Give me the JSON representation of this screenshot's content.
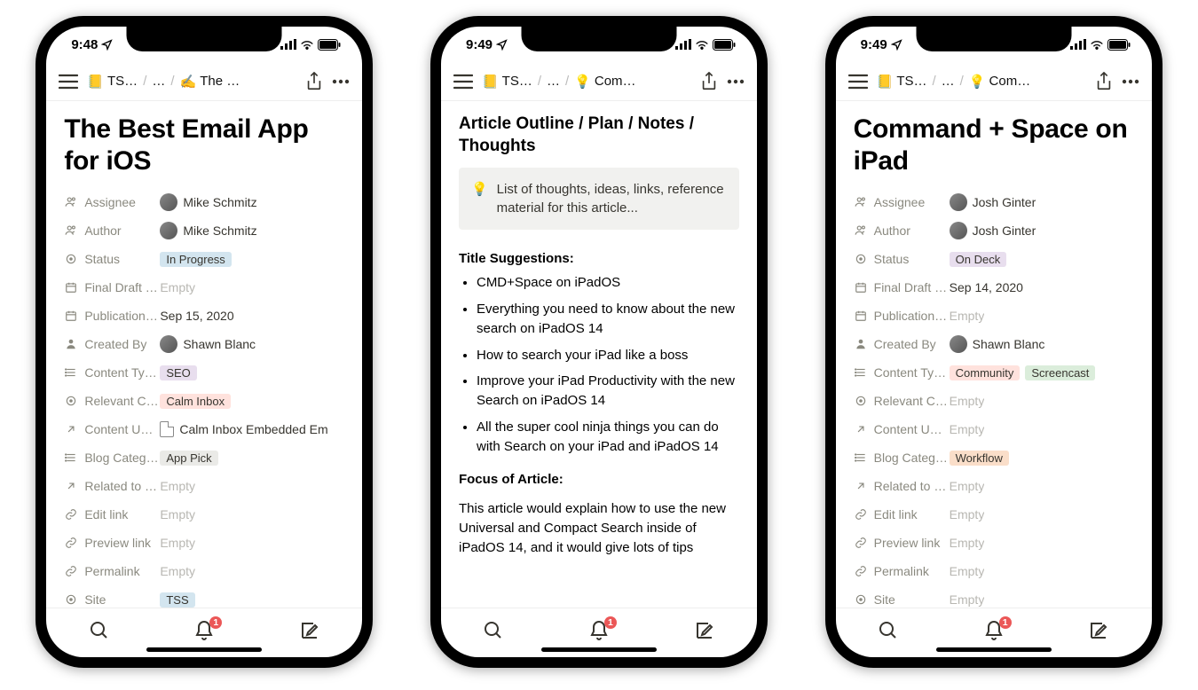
{
  "status_bar": {
    "time_a": "9:48",
    "time_b": "9:49",
    "time_c": "9:49"
  },
  "breadcrumb": {
    "root_emoji": "📒",
    "root": "TS…",
    "mid": "…",
    "leaf_a_emoji": "✍️",
    "leaf_a": "The …",
    "leaf_b_emoji": "💡",
    "leaf_b": "Com…",
    "leaf_c_emoji": "💡",
    "leaf_c": "Com…"
  },
  "phone1": {
    "title": "The Best Email App for iOS",
    "props": [
      {
        "icon": "person",
        "label": "Assignee",
        "type": "person",
        "name": "Mike Schmitz"
      },
      {
        "icon": "person",
        "label": "Author",
        "type": "person",
        "name": "Mike Schmitz"
      },
      {
        "icon": "status",
        "label": "Status",
        "type": "tag",
        "value": "In Progress",
        "color": "#d3e5ef"
      },
      {
        "icon": "date",
        "label": "Final Draft …",
        "type": "empty",
        "value": "Empty"
      },
      {
        "icon": "date",
        "label": "Publication…",
        "type": "text",
        "value": "Sep 15, 2020"
      },
      {
        "icon": "person-solid",
        "label": "Created By",
        "type": "person",
        "name": "Shawn Blanc"
      },
      {
        "icon": "multi",
        "label": "Content Ty…",
        "type": "tag",
        "value": "SEO",
        "color": "#e8deee"
      },
      {
        "icon": "status",
        "label": "Relevant C…",
        "type": "tag",
        "value": "Calm Inbox",
        "color": "#ffe2dd"
      },
      {
        "icon": "arrow",
        "label": "Content U…",
        "type": "file",
        "value": "Calm Inbox Embedded Em"
      },
      {
        "icon": "multi",
        "label": "Blog Categ…",
        "type": "tag",
        "value": "App Pick",
        "color": "#eaeae7"
      },
      {
        "icon": "arrow",
        "label": "Related to …",
        "type": "empty",
        "value": "Empty"
      },
      {
        "icon": "link",
        "label": "Edit link",
        "type": "empty",
        "value": "Empty"
      },
      {
        "icon": "link",
        "label": "Preview link",
        "type": "empty",
        "value": "Empty"
      },
      {
        "icon": "link",
        "label": "Permalink",
        "type": "empty",
        "value": "Empty"
      },
      {
        "icon": "status",
        "label": "Site",
        "type": "tag",
        "value": "TSS",
        "color": "#d3e5ef"
      }
    ]
  },
  "phone2": {
    "heading": "Article Outline / Plan / Notes / Thoughts",
    "callout_emoji": "💡",
    "callout_text": "List of thoughts, ideas, links, reference material for this article...",
    "suggestions_heading": "Title Suggestions:",
    "suggestions": [
      "CMD+Space on iPadOS",
      "Everything you need to know about the new search on iPadOS 14",
      "How to search your iPad like a boss",
      "Improve your iPad Productivity with the new Search on iPadOS 14",
      "All the super cool ninja things you can do with Search on your iPad and iPadOS 14"
    ],
    "focus_heading": "Focus of Article:",
    "focus_body": "This article would explain how to use the new Universal and Compact Search inside of iPadOS 14, and it would give lots of tips"
  },
  "phone3": {
    "title": "Command + Space on iPad",
    "props": [
      {
        "icon": "person",
        "label": "Assignee",
        "type": "person",
        "name": "Josh Ginter"
      },
      {
        "icon": "person",
        "label": "Author",
        "type": "person",
        "name": "Josh Ginter"
      },
      {
        "icon": "status",
        "label": "Status",
        "type": "tag",
        "value": "On Deck",
        "color": "#e8deee"
      },
      {
        "icon": "date",
        "label": "Final Draft …",
        "type": "text",
        "value": "Sep 14, 2020"
      },
      {
        "icon": "date",
        "label": "Publication…",
        "type": "empty",
        "value": "Empty"
      },
      {
        "icon": "person-solid",
        "label": "Created By",
        "type": "person",
        "name": "Shawn Blanc"
      },
      {
        "icon": "multi",
        "label": "Content Ty…",
        "type": "tags",
        "values": [
          {
            "v": "Community",
            "c": "#ffe2dd"
          },
          {
            "v": "Screencast",
            "c": "#dbeddb"
          }
        ]
      },
      {
        "icon": "status",
        "label": "Relevant C…",
        "type": "empty",
        "value": "Empty"
      },
      {
        "icon": "arrow",
        "label": "Content U…",
        "type": "empty",
        "value": "Empty"
      },
      {
        "icon": "multi",
        "label": "Blog Categ…",
        "type": "tag",
        "value": "Workflow",
        "color": "#fadec9"
      },
      {
        "icon": "arrow",
        "label": "Related to …",
        "type": "empty",
        "value": "Empty"
      },
      {
        "icon": "link",
        "label": "Edit link",
        "type": "empty",
        "value": "Empty"
      },
      {
        "icon": "link",
        "label": "Preview link",
        "type": "empty",
        "value": "Empty"
      },
      {
        "icon": "link",
        "label": "Permalink",
        "type": "empty",
        "value": "Empty"
      },
      {
        "icon": "status",
        "label": "Site",
        "type": "empty",
        "value": "Empty"
      }
    ]
  },
  "tabs": {
    "badge": "1"
  }
}
